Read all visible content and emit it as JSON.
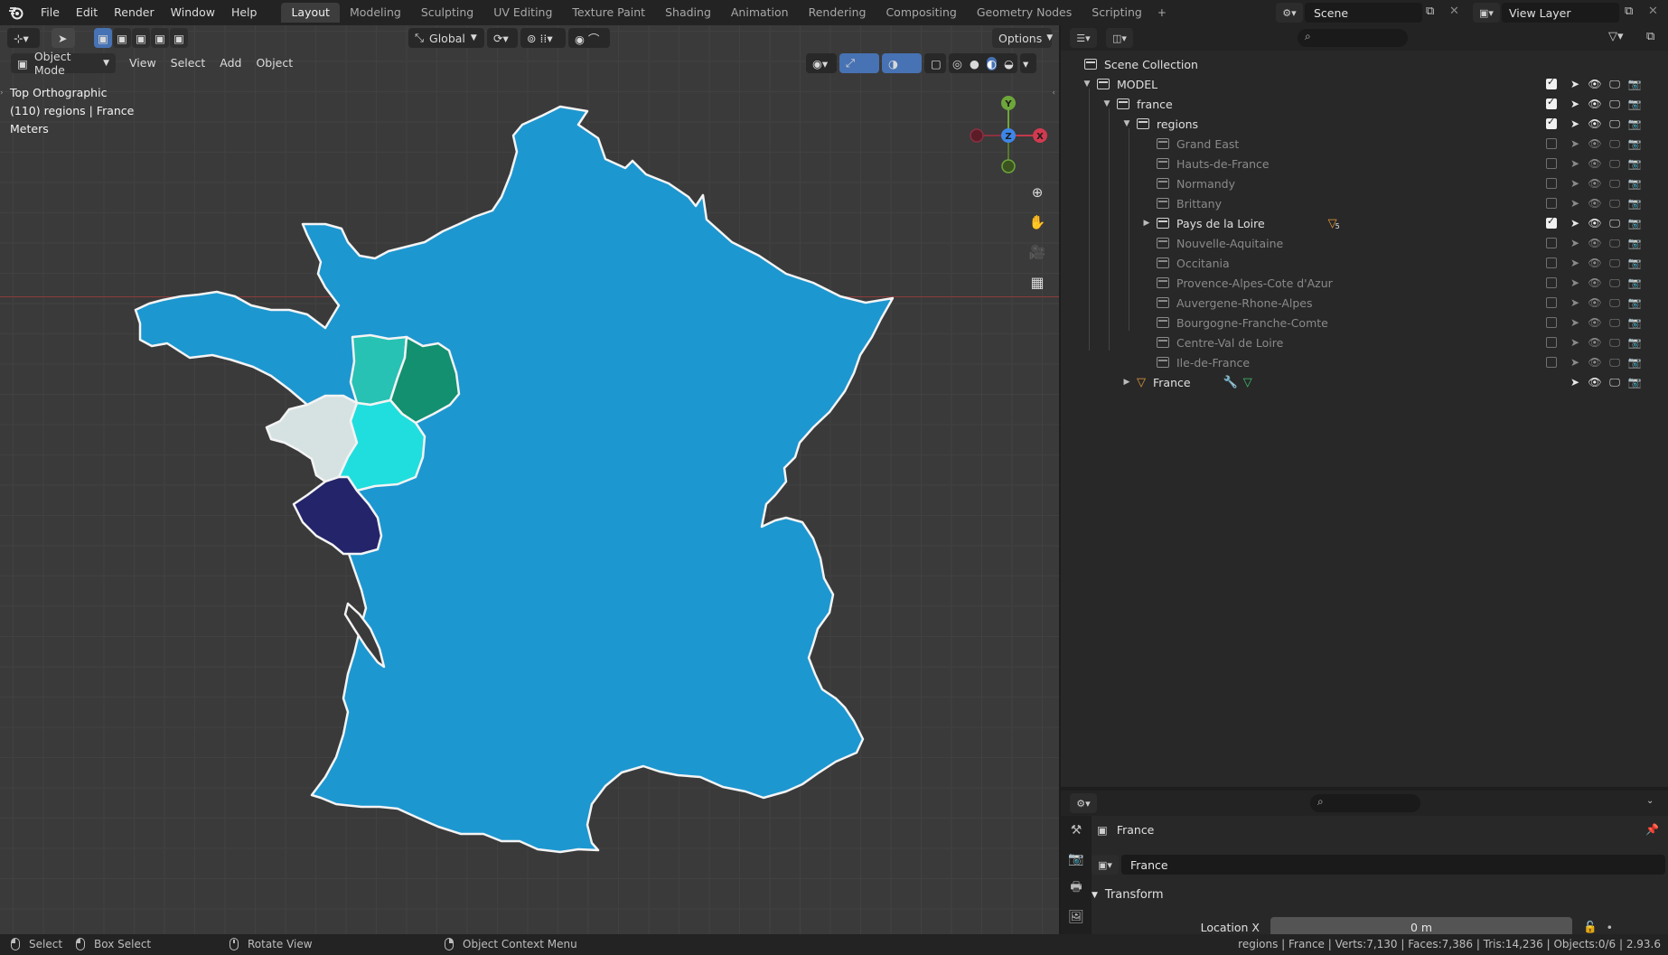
{
  "app": {
    "name": "Blender"
  },
  "topbar": {
    "menus": [
      "File",
      "Edit",
      "Render",
      "Window",
      "Help"
    ],
    "workspaces": [
      "Layout",
      "Modeling",
      "Sculpting",
      "UV Editing",
      "Texture Paint",
      "Shading",
      "Animation",
      "Rendering",
      "Compositing",
      "Geometry Nodes",
      "Scripting"
    ],
    "active_workspace": "Layout",
    "scene_name": "Scene",
    "view_layer_name": "View Layer"
  },
  "viewport": {
    "orientation_label": "Global",
    "options_label": "Options",
    "mode_label": "Object Mode",
    "header_menus": [
      "View",
      "Select",
      "Add",
      "Object"
    ],
    "overlay_lines": [
      "Top Orthographic",
      "(110) regions | France",
      "Meters"
    ],
    "gizmo_axes": {
      "y": "Y",
      "z": "Z",
      "x": "X"
    },
    "colors": {
      "france": "#1d97d0",
      "region_teal_light": "#27c2b4",
      "region_green": "#129070",
      "region_pale": "#d6e2e2",
      "region_cyan": "#20dede",
      "region_navy": "#23246a",
      "x_axis_line": "#8d3b3b"
    }
  },
  "outliner": {
    "root": "Scene Collection",
    "items": [
      {
        "label": "MODEL",
        "depth": 0,
        "expanded": true,
        "checked": true,
        "dim": false
      },
      {
        "label": "france",
        "depth": 1,
        "expanded": true,
        "checked": true,
        "dim": false
      },
      {
        "label": "regions",
        "depth": 2,
        "expanded": true,
        "checked": true,
        "dim": false
      },
      {
        "label": "Grand East",
        "depth": 3,
        "checked": false,
        "dim": true
      },
      {
        "label": "Hauts-de-France",
        "depth": 3,
        "checked": false,
        "dim": true
      },
      {
        "label": "Normandy",
        "depth": 3,
        "checked": false,
        "dim": true
      },
      {
        "label": "Brittany",
        "depth": 3,
        "checked": false,
        "dim": true
      },
      {
        "label": "Pays de la Loire",
        "depth": 3,
        "checked": true,
        "dim": false,
        "collapsed_children": true,
        "badge": "5"
      },
      {
        "label": "Nouvelle-Aquitaine",
        "depth": 3,
        "checked": false,
        "dim": true
      },
      {
        "label": "Occitania",
        "depth": 3,
        "checked": false,
        "dim": true
      },
      {
        "label": "Provence-Alpes-Cote d'Azur",
        "depth": 3,
        "checked": false,
        "dim": true
      },
      {
        "label": "Auvergene-Rhone-Alpes",
        "depth": 3,
        "checked": false,
        "dim": true
      },
      {
        "label": "Bourgogne-Franche-Comte",
        "depth": 3,
        "checked": false,
        "dim": true
      },
      {
        "label": "Centre-Val de Loire",
        "depth": 3,
        "checked": false,
        "dim": true
      },
      {
        "label": "Ile-de-France",
        "depth": 3,
        "checked": false,
        "dim": true
      },
      {
        "label": "France",
        "depth": 2,
        "is_object": true,
        "dim": false
      }
    ]
  },
  "properties": {
    "context_name": "France",
    "object_name": "France",
    "panel_title": "Transform",
    "location_x_label": "Location X",
    "location_x_value": "0 m"
  },
  "statusbar": {
    "select": "Select",
    "box_select": "Box Select",
    "rotate_view": "Rotate View",
    "context_menu": "Object Context Menu",
    "stats": "regions | France | Verts:7,130 | Faces:7,386 | Tris:14,236 | Objects:0/6 | 2.93.6"
  }
}
